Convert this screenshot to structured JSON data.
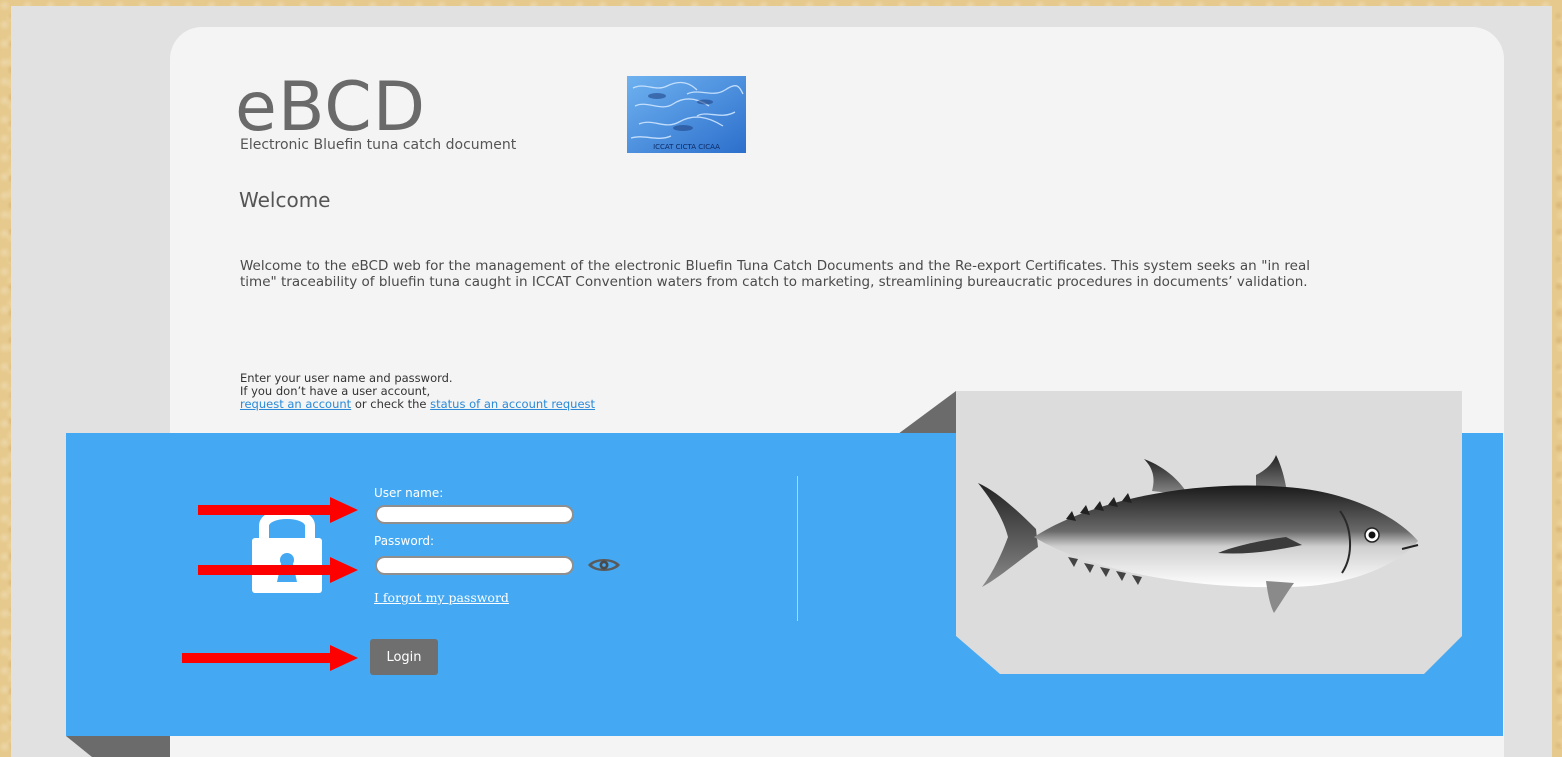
{
  "header": {
    "app_title": "eBCD",
    "app_subtitle": "Electronic Bluefin tuna catch document",
    "logo_text": "ICCAT  CICTA  CICAA"
  },
  "welcome": {
    "heading": "Welcome",
    "intro": "Welcome to the eBCD web for the management of the electronic Bluefin Tuna Catch Documents and the Re-export Certificates. This system seeks an \"in real time\" traceability of bluefin tuna caught in ICCAT Convention waters from catch to marketing, streamlining bureaucratic procedures in documents’ validation."
  },
  "instructions": {
    "line1": "Enter your user name and password.",
    "line2": "If you don’t have a user account,",
    "request_link": "request an account",
    "middle": " or check the ",
    "status_link": "status of an account request"
  },
  "login": {
    "username_label": "User name:",
    "username_value": "",
    "password_label": "Password:",
    "password_value": "",
    "forgot_link": "I forgot my password",
    "login_button": "Login"
  },
  "icons": {
    "lock": "lock-icon",
    "eye": "eye-icon",
    "arrows": "arrow-right-icon",
    "fish": "bluefin-tuna-image"
  },
  "colors": {
    "band": "#44a9f2",
    "card": "#f4f4f4",
    "button": "#6f6f6f",
    "link": "#2a8ad8",
    "arrow": "#ff0000"
  }
}
